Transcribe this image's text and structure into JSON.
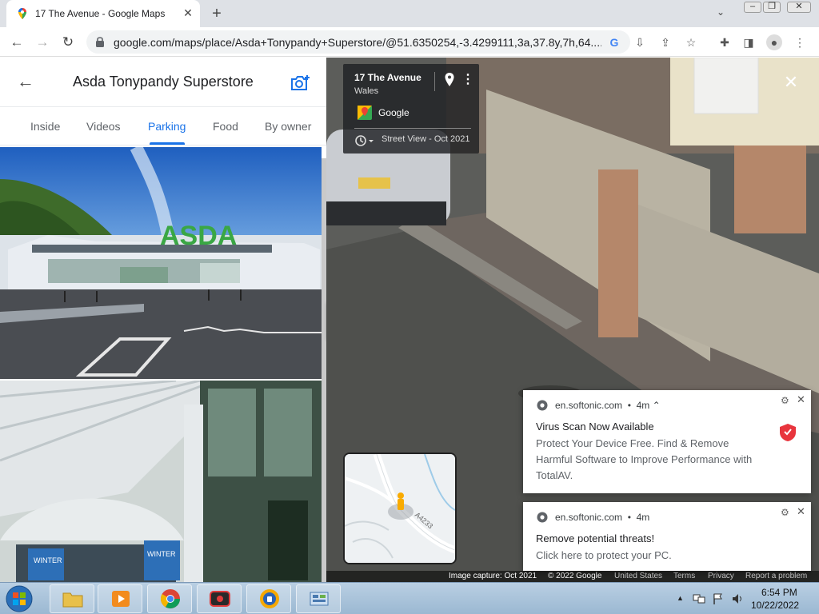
{
  "browser": {
    "tab_title": "17 The Avenue - Google Maps",
    "url": "google.com/maps/place/Asda+Tonypandy+Superstore/@51.6350254,-3.4299111,3a,37.8y,7h,64...."
  },
  "place": {
    "title": "Asda Tonypandy Superstore",
    "tabs": [
      "Inside",
      "Videos",
      "Parking",
      "Food",
      "By owner"
    ],
    "active_tab": "Parking",
    "photo_sign": "ASDA"
  },
  "streetview": {
    "address": "17 The Avenue",
    "region": "Wales",
    "provider": "Google",
    "capture": "Street View - Oct 2021",
    "minimap_road": "A4233",
    "footer": {
      "capture": "Image capture: Oct 2021",
      "copyright": "© 2022 Google",
      "region": "United States",
      "terms": "Terms",
      "privacy": "Privacy",
      "report": "Report a problem"
    }
  },
  "notifications": [
    {
      "source": "en.softonic.com",
      "age": "4m",
      "title": "Virus Scan Now Available",
      "body": "Protect Your Device Free. Find & Remove Harmful Software to Improve Performance with TotalAV."
    },
    {
      "source": "en.softonic.com",
      "age": "4m",
      "title": "Remove potential threats!",
      "body": "Click here to protect your PC."
    }
  ],
  "taskbar": {
    "time": "6:54 PM",
    "date": "10/22/2022"
  },
  "colors": {
    "accent": "#1a73e8",
    "taskbar": "#a9c3dc"
  }
}
